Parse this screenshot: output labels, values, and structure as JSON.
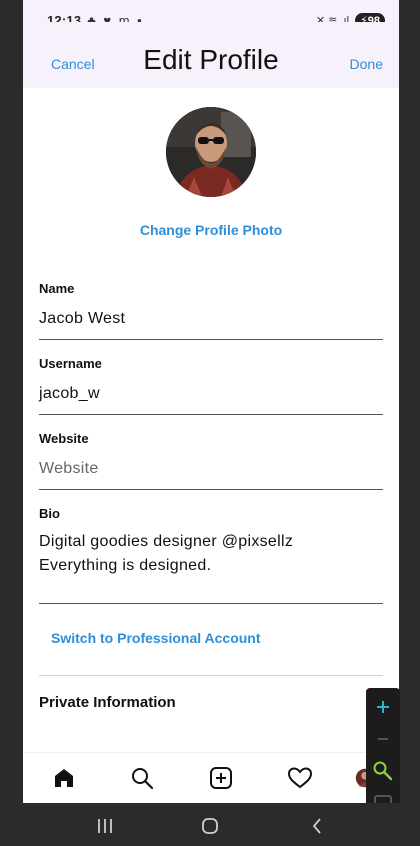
{
  "status_bar": {
    "time": "12:13",
    "left_icons": "♣ ♥ m •",
    "right_icons": "✕ ≋ .ıl",
    "battery": "98"
  },
  "header": {
    "cancel_label": "Cancel",
    "title": "Edit Profile",
    "done_label": "Done"
  },
  "profile": {
    "change_photo_label": "Change Profile Photo"
  },
  "form": {
    "name": {
      "label": "Name",
      "value": "Jacob West"
    },
    "username": {
      "label": "Username",
      "value": "jacob_w"
    },
    "website": {
      "label": "Website",
      "placeholder": "Website",
      "value": ""
    },
    "bio": {
      "label": "Bio",
      "line1": "Digital goodies designer @pixsellz",
      "line2": "Everything is designed."
    }
  },
  "switch_professional_label": "Switch to Professional Account",
  "private_information_label": "Private Information",
  "tab_bar": {
    "items": [
      "home-icon",
      "search-icon",
      "add-post-icon",
      "heart-icon",
      "profile-avatar"
    ]
  },
  "zoom_controls": {
    "items": [
      "plus-icon",
      "minus-icon",
      "zoom-search-icon",
      "fit-screen-icon"
    ],
    "accent": "#29b6c8",
    "search_accent": "#8bd43a"
  },
  "colors": {
    "link": "#2e8fd8",
    "header_bg": "#f6f1fb"
  }
}
